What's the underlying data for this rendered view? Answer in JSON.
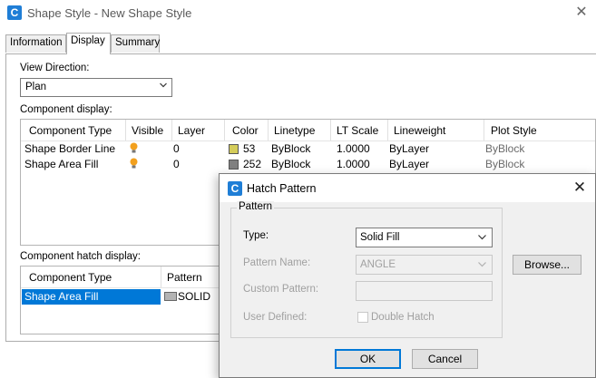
{
  "main_window": {
    "title": "Shape Style - New Shape Style",
    "logo_letter": "C",
    "close_glyph": "✕"
  },
  "tabs": [
    {
      "label": "Information",
      "active": false
    },
    {
      "label": "Display",
      "active": true
    },
    {
      "label": "Summary",
      "active": false
    }
  ],
  "view_direction": {
    "label": "View Direction:",
    "value": "Plan"
  },
  "component_display": {
    "label": "Component display:",
    "columns": [
      "Component Type",
      "Visible",
      "Layer",
      "Color",
      "Linetype",
      "LT Scale",
      "Lineweight",
      "Plot Style"
    ],
    "rows": [
      {
        "component_type": "Shape Border Line",
        "visible_icon": "lightbulb-on-icon",
        "layer": "0",
        "color_swatch": "#d4cc5a",
        "color": "53",
        "linetype": "ByBlock",
        "lt_scale": "1.0000",
        "lineweight": "ByLayer",
        "plot_style": "ByBlock"
      },
      {
        "component_type": "Shape Area Fill",
        "visible_icon": "lightbulb-on-icon",
        "layer": "0",
        "color_swatch": "#808080",
        "color": "252",
        "linetype": "ByBlock",
        "lt_scale": "1.0000",
        "lineweight": "ByLayer",
        "plot_style": "ByBlock"
      }
    ]
  },
  "component_hatch_display": {
    "label": "Component hatch display:",
    "columns": [
      "Component Type",
      "Pattern"
    ],
    "rows": [
      {
        "component_type": "Shape Area Fill",
        "pattern_swatch": "#b4b4b4",
        "pattern": "SOLID",
        "selected": true
      }
    ]
  },
  "hatch_dialog": {
    "title": "Hatch Pattern",
    "logo_letter": "C",
    "close_glyph": "✕",
    "group_label": "Pattern",
    "type_label": "Type:",
    "type_value": "Solid Fill",
    "pattern_name_label": "Pattern Name:",
    "pattern_name_value": "ANGLE",
    "custom_pattern_label": "Custom Pattern:",
    "custom_pattern_value": "",
    "user_defined_label": "User Defined:",
    "double_hatch_label": "Double Hatch",
    "double_hatch_checked": false,
    "browse_label": "Browse...",
    "ok_label": "OK",
    "cancel_label": "Cancel"
  },
  "colors": {
    "accent": "#0078d7",
    "logo_blue": "#1f7ed6",
    "selection": "#0078d7",
    "bulb": "#f2a01e"
  }
}
